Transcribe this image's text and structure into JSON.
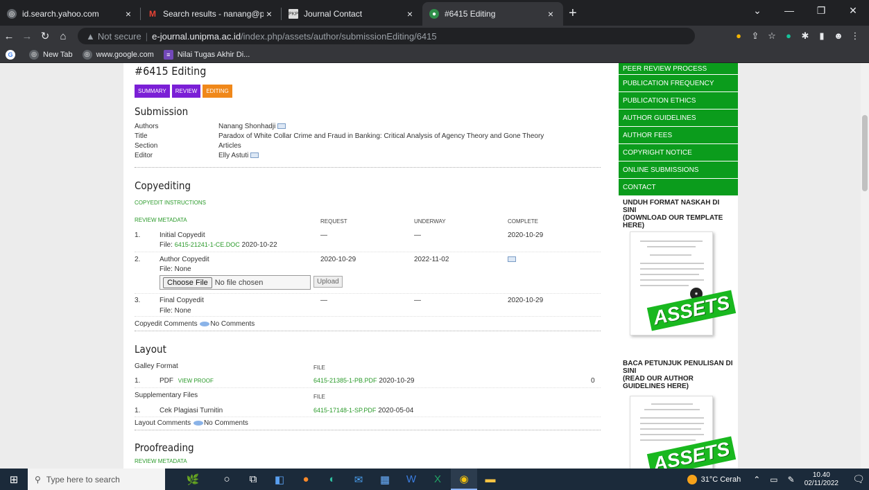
{
  "tabs": [
    {
      "title": "id.search.yahoo.com",
      "favicon": "globe-icon",
      "active": false
    },
    {
      "title": "Search results - nanang@perban...",
      "favicon": "gmail-icon",
      "active": false
    },
    {
      "title": "Journal Contact",
      "favicon": "pkp-icon",
      "active": false
    },
    {
      "title": "#6415 Editing",
      "favicon": "journal-icon",
      "active": true
    }
  ],
  "address": {
    "security": "Not secure",
    "host": "e-journal.unipma.ac.id",
    "path": "/index.php/assets/author/submissionEditing/6415"
  },
  "bookmarks": [
    {
      "label": "New Tab",
      "icon": "globe-icon"
    },
    {
      "label": "www.google.com",
      "icon": "globe-icon"
    },
    {
      "label": "Nilai Tugas Akhir Di...",
      "icon": "sheets-icon"
    }
  ],
  "page": {
    "title": "#6415 Editing",
    "pills": [
      "SUMMARY",
      "REVIEW",
      "EDITING"
    ],
    "submission": {
      "heading": "Submission",
      "rows": [
        {
          "label": "Authors",
          "value": "Nanang Shonhadji"
        },
        {
          "label": "Title",
          "value": "Paradox of White Collar Crime and Fraud in Banking: Critical Analysis of Agency Theory and Gone Theory"
        },
        {
          "label": "Section",
          "value": "Articles"
        },
        {
          "label": "Editor",
          "value": "Elly Astuti"
        }
      ]
    },
    "copyediting": {
      "heading": "Copyediting",
      "instructions": "COPYEDIT INSTRUCTIONS",
      "review_metadata": "REVIEW METADATA",
      "cols": [
        "REQUEST",
        "UNDERWAY",
        "COMPLETE"
      ],
      "items": [
        {
          "num": "1.",
          "name": "Initial Copyedit",
          "file_label": "File:",
          "file": "6415-21241-1-CE.DOC",
          "file_date": "2020-10-22",
          "request": "—",
          "underway": "—",
          "complete": "2020-10-29"
        },
        {
          "num": "2.",
          "name": "Author Copyedit",
          "file_label": "File: None",
          "request": "2020-10-29",
          "underway": "2022-11-02",
          "complete": ""
        },
        {
          "num": "3.",
          "name": "Final Copyedit",
          "file_label": "File: None",
          "request": "—",
          "underway": "—",
          "complete": "2020-10-29"
        }
      ],
      "choose_file": "Choose File",
      "no_file": "No file chosen",
      "upload": "Upload",
      "comments_label": "Copyedit Comments",
      "comments_value": "No Comments"
    },
    "layout": {
      "heading": "Layout",
      "galley_label": "Galley Format",
      "file_col": "FILE",
      "galley": {
        "num": "1.",
        "format": "PDF",
        "proof": "VIEW PROOF",
        "file": "6415-21385-1-PB.PDF",
        "date": "2020-10-29",
        "count": "0"
      },
      "supp_label": "Supplementary Files",
      "supp": {
        "num": "1.",
        "name": "Cek Plagiasi Turnitin",
        "file": "6415-17148-1-SP.PDF",
        "date": "2020-05-04"
      },
      "comments_label": "Layout Comments",
      "comments_value": "No Comments"
    },
    "proofreading": {
      "heading": "Proofreading",
      "review_metadata": "REVIEW METADATA"
    }
  },
  "sidebar": {
    "menu": [
      "PEER REVIEW PROCESS",
      "PUBLICATION FREQUENCY",
      "PUBLICATION ETHICS",
      "AUTHOR GUIDELINES",
      "AUTHOR FEES",
      "COPYRIGHT NOTICE",
      "ONLINE SUBMISSIONS",
      "CONTACT"
    ],
    "template_heading": "UNDUH FORMAT NASKAH DI SINI\n(DOWNLOAD OUR TEMPLATE HERE)",
    "guidelines_heading": "BACA PETUNJUK PENULISAN DI SINI\n(READ OUR AUTHOR GUIDELINES HERE)",
    "cover_logo": "ASSETS"
  },
  "taskbar": {
    "search_placeholder": "Type here to search",
    "weather": "31°C  Cerah",
    "time": "10.40",
    "date": "02/11/2022"
  },
  "colors": {
    "menu_green": "#0b9c1c",
    "link_green": "#2a9a2a",
    "pill_purple": "#7b1fd6",
    "pill_orange": "#f0881a"
  }
}
